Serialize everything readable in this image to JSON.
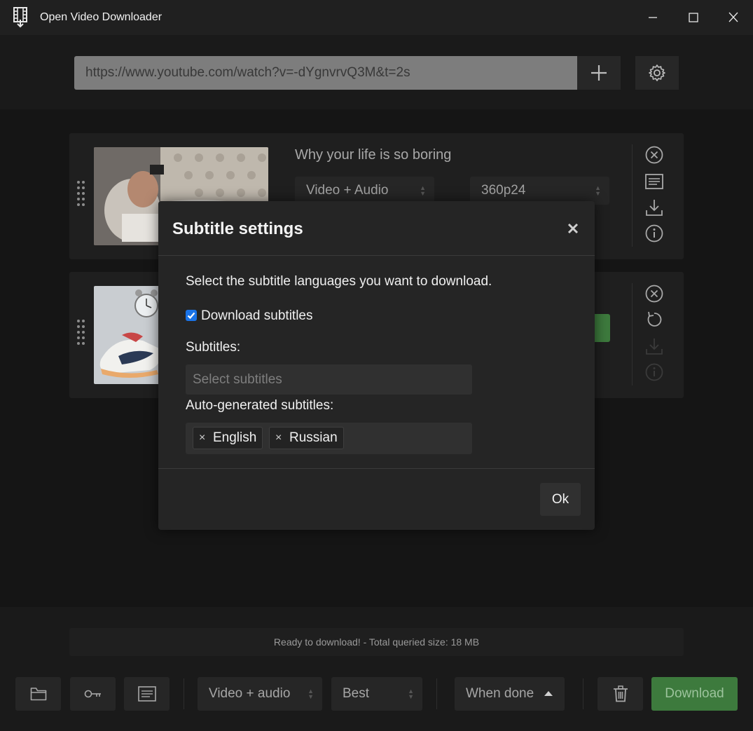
{
  "window": {
    "title": "Open Video Downloader",
    "icon": "film-download-icon"
  },
  "url_bar": {
    "value": "https://www.youtube.com/watch?v=-dYgnvrvQ3M&t=2s",
    "add_icon": "plus-icon",
    "settings_icon": "gear-icon"
  },
  "cards": [
    {
      "title": "Why your life is so boring",
      "type_select": "Video + Audio",
      "quality_select": "360p24",
      "actions": [
        "close-circle-icon",
        "subtitles-icon",
        "download-icon",
        "info-icon"
      ]
    },
    {
      "title": "",
      "actions": [
        "close-circle-icon",
        "retry-icon",
        "download-icon",
        "info-icon"
      ]
    }
  ],
  "modal": {
    "title": "Subtitle settings",
    "description": "Select the subtitle languages you want to download.",
    "checkbox_label": "Download subtitles",
    "checkbox_checked": true,
    "subtitles_label": "Subtitles:",
    "subtitles_placeholder": "Select subtitles",
    "auto_label": "Auto-generated subtitles:",
    "auto_tags": [
      "English",
      "Russian"
    ],
    "ok_label": "Ok"
  },
  "footer": {
    "status": "Ready to download! - Total queried size: 18 MB",
    "type_select": "Video + audio",
    "quality_select": "Best",
    "when_done_label": "When done",
    "download_label": "Download"
  },
  "colors": {
    "accent_green": "#3d7a3d",
    "checkbox_blue": "#1a73e8"
  }
}
